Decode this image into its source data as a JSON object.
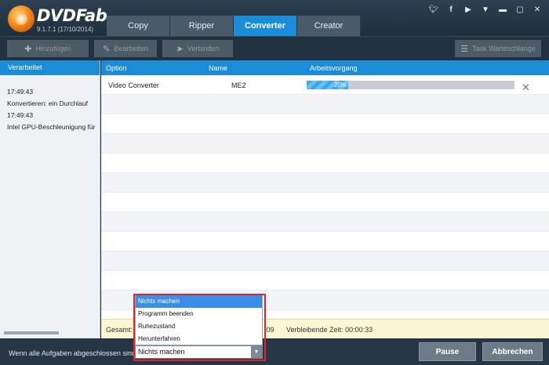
{
  "app": {
    "brand": "DVDFab",
    "version": "9.1.7.1 (17/10/2014)"
  },
  "tabs": [
    {
      "label": "Copy",
      "active": false
    },
    {
      "label": "Ripper",
      "active": false
    },
    {
      "label": "Converter",
      "active": true
    },
    {
      "label": "Creator",
      "active": false
    }
  ],
  "window_controls": [
    "twitter-icon",
    "facebook-icon",
    "youtube-icon",
    "menu-dropdown-icon",
    "minimize-icon",
    "maximize-icon",
    "close-icon"
  ],
  "toolbar": {
    "add_label": "Hinzufügen",
    "edit_label": "Bearbeiten",
    "merge_label": "Verbinden",
    "queue_label": "Task Warteschlange"
  },
  "left_panel": {
    "header": "Verarbeitet",
    "log": [
      "17:49:43",
      "Konvertieren: ein Durchlauf",
      "17:49:43",
      "Intel GPU-Beschleunigung für die '"
    ]
  },
  "grid": {
    "headers": {
      "option": "Option",
      "name": "Name",
      "progress": "Arbeitsvorgang"
    },
    "task": {
      "option": "Video Converter",
      "name": "ME2",
      "progress_percent": 20,
      "progress_label": "20%"
    }
  },
  "status": {
    "total_label": "Gesamt:",
    "elapsed_fragment": ":09",
    "remaining": "Verbleibende Zeit: 00:00:33"
  },
  "bottom": {
    "on_complete_label": "Wenn alle Aufgaben abgeschlossen sind:",
    "selected": "Nichts machen",
    "options": [
      "Nichts machen",
      "Programm beenden",
      "Ruhezustand",
      "Herunterfahren"
    ],
    "pause_label": "Pause",
    "cancel_label": "Abbrechen"
  },
  "colors": {
    "accent": "#1a8cd8",
    "highlight_box": "#e0262b",
    "status_bg": "#fbf6d4"
  }
}
